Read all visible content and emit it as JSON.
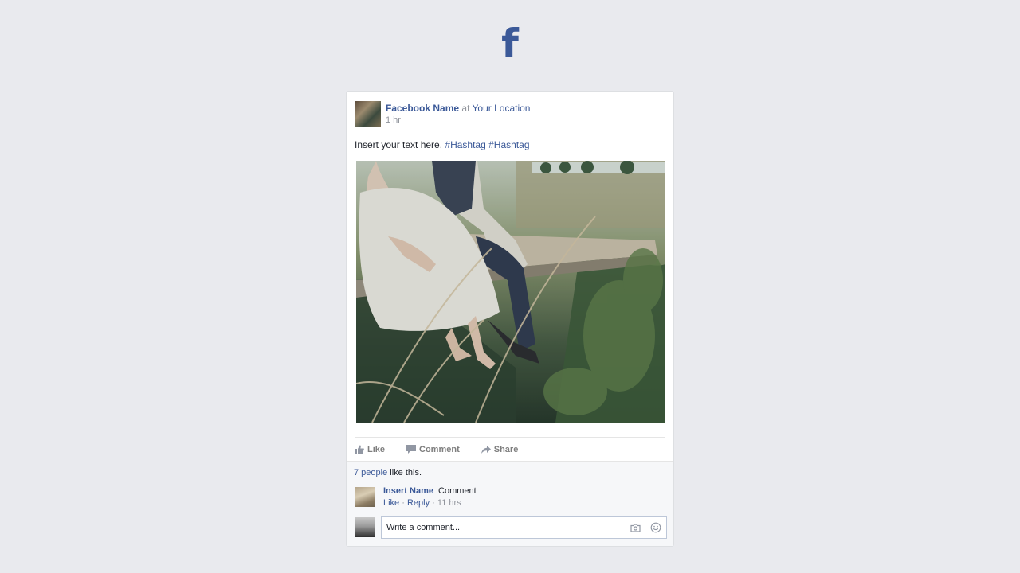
{
  "brand": {
    "logo_letter": "f",
    "color": "#3b5998"
  },
  "post": {
    "author": "Facebook Name",
    "at_text": "at",
    "location": "Your Location",
    "time": "1 hr",
    "text": "Insert your text here.",
    "hashtags": [
      "#Hashtag",
      "#Hashtag"
    ],
    "photo_icon": "wedding-photo"
  },
  "actions": {
    "like": "Like",
    "comment": "Comment",
    "share": "Share"
  },
  "likes": {
    "count_text": "7 people",
    "suffix": "like this."
  },
  "comment": {
    "name": "Insert Name",
    "text": "Comment",
    "like": "Like",
    "separator": "·",
    "reply": "Reply",
    "time": "11 hrs"
  },
  "composer": {
    "placeholder": "Write a comment..."
  }
}
